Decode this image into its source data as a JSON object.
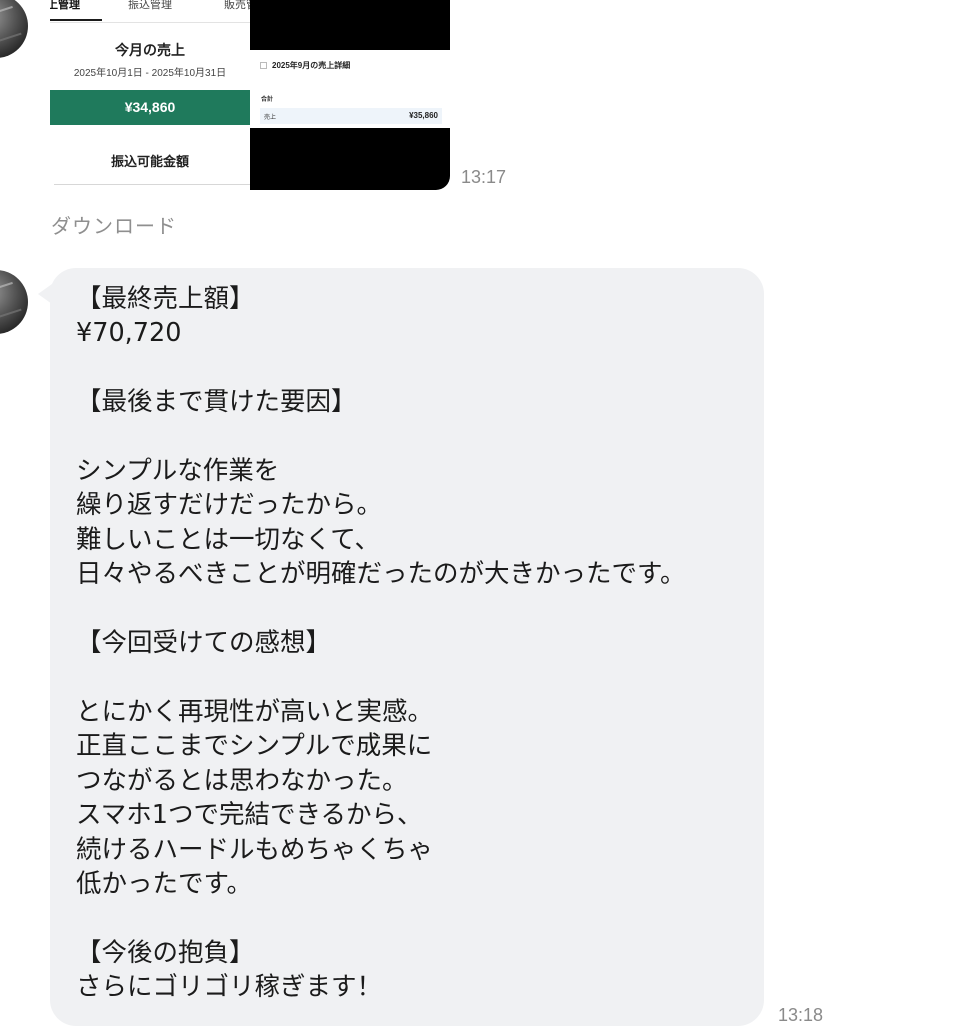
{
  "message1": {
    "tabs": [
      "売上管理",
      "振込管理",
      "販売管理"
    ],
    "title": "今月の売上",
    "period": "2025年10月1日 - 2025年10月31日",
    "amount": "¥34,860",
    "transfer_label": "振込可能金額",
    "detail_title": "2025年9月の売上詳細",
    "total_label": "合計",
    "row_label": "売上",
    "row_value": "¥35,860",
    "time": "13:17"
  },
  "download_label": "ダウンロード",
  "message2": {
    "text": "【最終売上額】\n¥70,720\n\n【最後まで貫けた要因】\n\nシンプルな作業を\n繰り返すだけだったから。\n難しいことは一切なくて、\n日々やるべきことが明確だったのが大きかったです。\n\n【今回受けての感想】\n\nとにかく再現性が高いと実感。\n正直ここまでシンプルで成果に\nつながるとは思わなかった。\nスマホ1つで完結できるから、\n続けるハードルもめちゃくちゃ\n低かったです。\n\n【今後の抱負】\nさらにゴリゴリ稼ぎます！",
    "time": "13:18"
  },
  "colors": {
    "accent_green": "#1f7a5c",
    "bubble_bg": "#f0f1f3",
    "timestamp": "#8a8a8a"
  }
}
